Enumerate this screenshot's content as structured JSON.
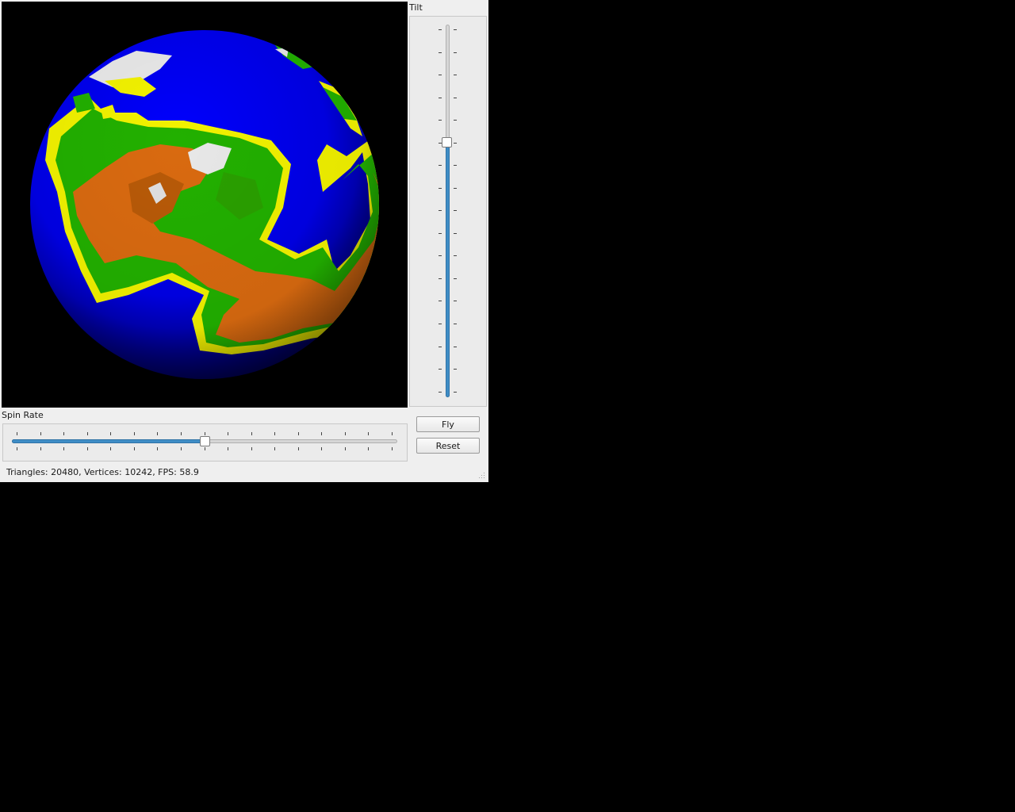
{
  "tilt": {
    "label": "Tilt",
    "value_fraction": 0.68
  },
  "spin_rate": {
    "label": "Spin Rate",
    "value_fraction": 0.5
  },
  "buttons": {
    "fly": "Fly",
    "reset": "Reset"
  },
  "status": {
    "text": "Triangles: 20480, Vertices: 10242, FPS: 58.9"
  },
  "colors": {
    "ocean": "#0000f0",
    "lowland": "#22b000",
    "coast": "#f2f200",
    "mountain": "#d96a10",
    "snow": "#e8e8e8",
    "accent": "#3f8dc6",
    "window_bg": "#efefef"
  }
}
